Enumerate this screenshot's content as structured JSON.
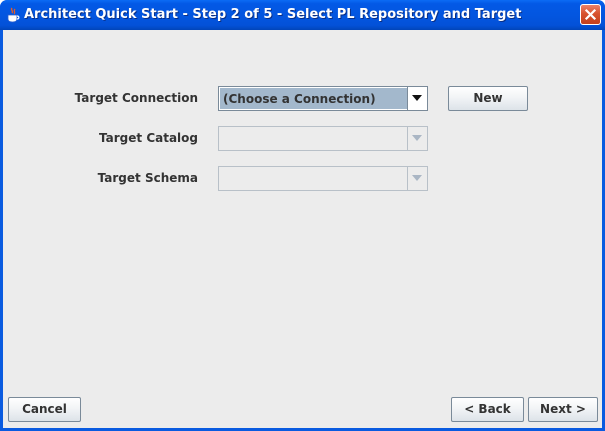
{
  "window": {
    "title": "Architect Quick Start - Step 2 of 5 - Select PL Repository and Target",
    "title_icon": "java-cup-icon",
    "close_icon": "close-icon"
  },
  "form": {
    "target_connection": {
      "label": "Target Connection",
      "value": "(Choose a Connection)",
      "enabled": true
    },
    "target_catalog": {
      "label": "Target Catalog",
      "value": "",
      "enabled": false
    },
    "target_schema": {
      "label": "Target Schema",
      "value": "",
      "enabled": false
    },
    "new_button_label": "New"
  },
  "footer": {
    "cancel_label": "Cancel",
    "back_label": "< Back",
    "next_label": "Next >"
  },
  "colors": {
    "titlebar": "#0356e0",
    "client_bg": "#ececec",
    "combo_selected": "#a3b8cc",
    "close_button": "#d8532f"
  }
}
